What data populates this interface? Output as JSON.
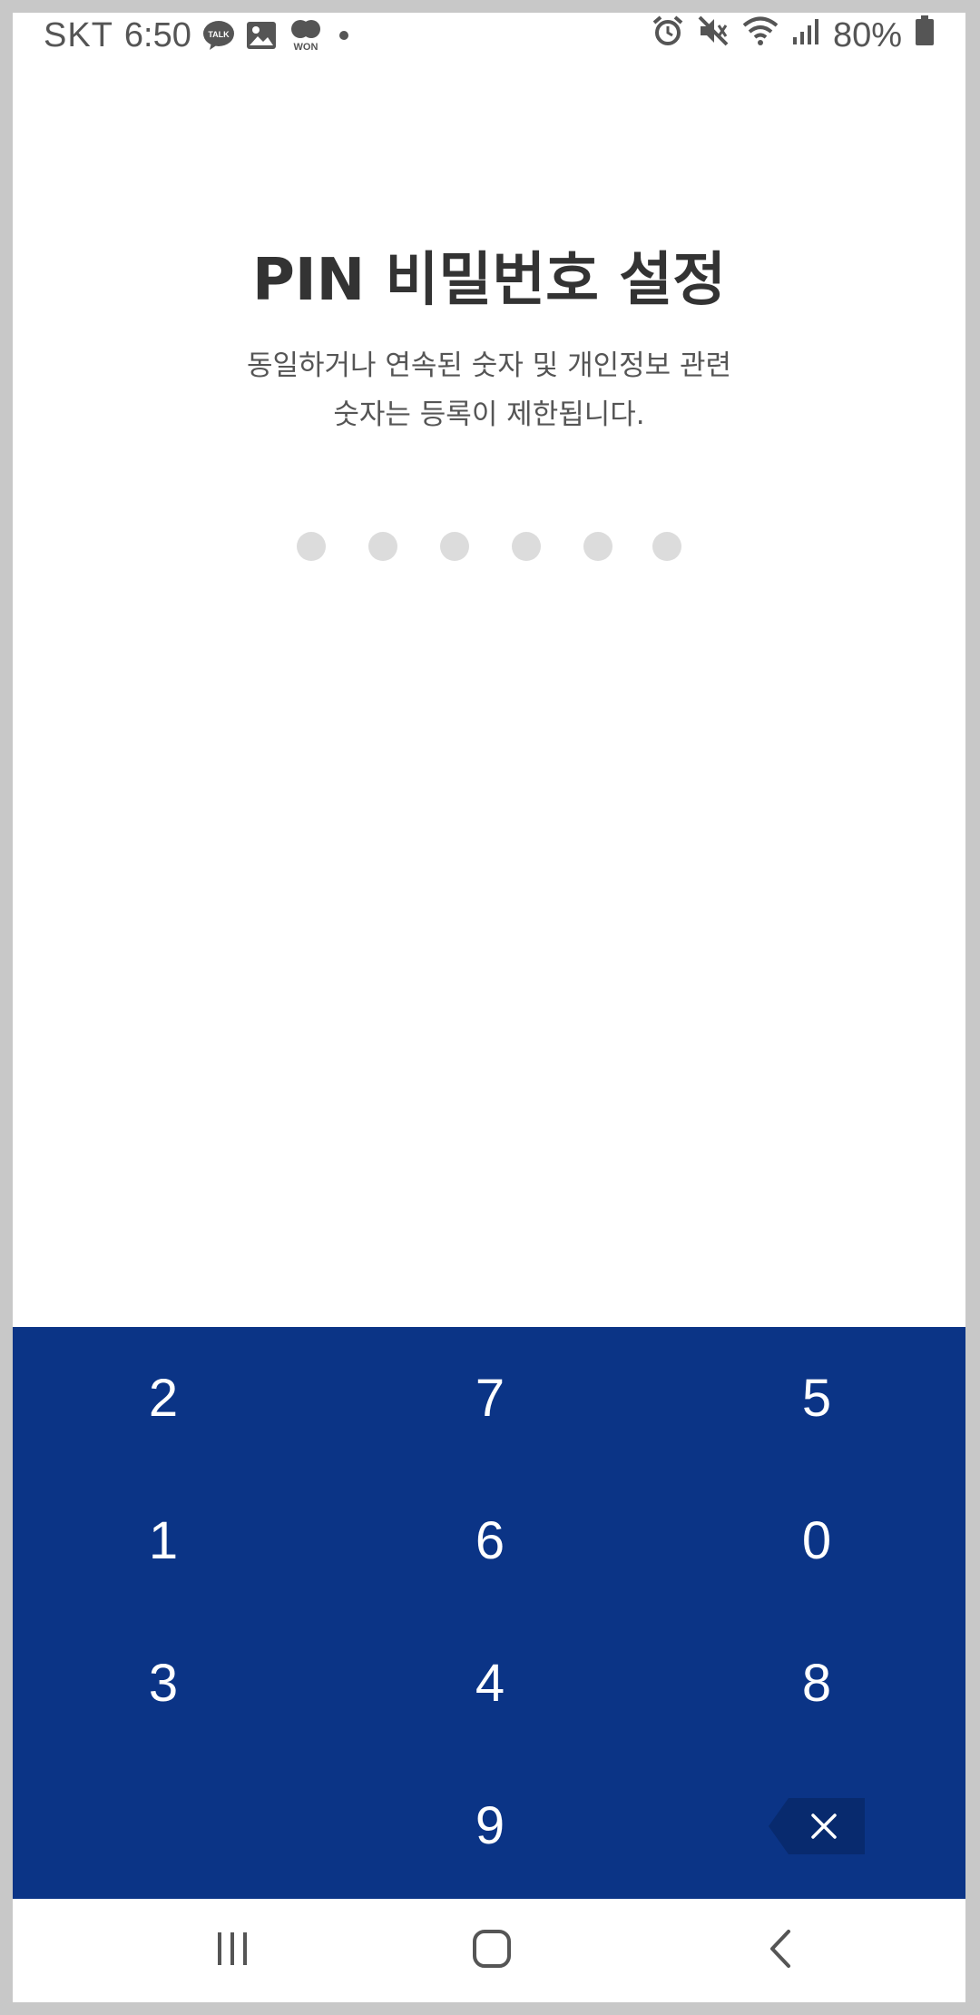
{
  "status_bar": {
    "carrier": "SKT",
    "time": "6:50",
    "notifications": [
      "kakaotalk-icon",
      "gallery-icon",
      "won-app-icon",
      "more-dot-icon"
    ],
    "kakaotalk_label": "TALK",
    "won_label": "WON",
    "right_icons": [
      "alarm-icon",
      "mute-icon",
      "wifi-icon",
      "signal-icon"
    ],
    "battery": "80%"
  },
  "header": {
    "title": "PIN 비밀번호 설정",
    "subtitle_line1": "동일하거나 연속된 숫자 및 개인정보 관련",
    "subtitle_line2": "숫자는 등록이 제한됩니다."
  },
  "pin": {
    "length": 6,
    "entered": 0,
    "dot_color_empty": "#dcdcdc"
  },
  "keypad": {
    "background": "#0b3486",
    "keys": {
      "r1c1": "2",
      "r1c2": "7",
      "r1c3": "5",
      "r2c1": "1",
      "r2c2": "6",
      "r2c3": "0",
      "r3c1": "3",
      "r3c2": "4",
      "r3c3": "8",
      "r4c2": "9"
    },
    "backspace_icon": "backspace-icon"
  },
  "nav_bar": {
    "buttons": [
      "recent-apps-icon",
      "home-icon",
      "back-icon"
    ]
  }
}
